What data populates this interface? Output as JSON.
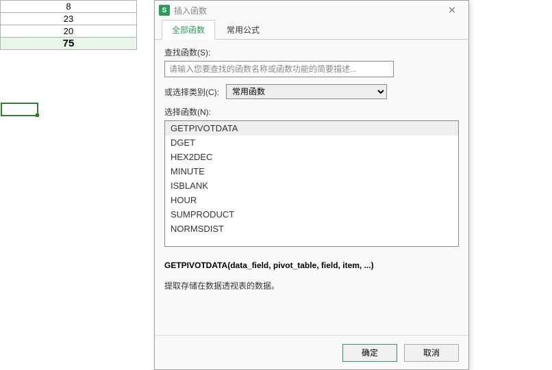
{
  "spreadsheet": {
    "cells": [
      "8",
      "23",
      "20",
      "75"
    ]
  },
  "dialog": {
    "title": "插入函数",
    "app_icon_letter": "S",
    "tabs": {
      "all": "全部函数",
      "common": "常用公式"
    },
    "search": {
      "label": "查找函数(S):",
      "placeholder": "请输入您要查找的函数名称或函数功能的简要描述..."
    },
    "category": {
      "label": "或选择类别(C):",
      "selected": "常用函数"
    },
    "select_fn_label": "选择函数(N):",
    "functions": [
      "GETPIVOTDATA",
      "DGET",
      "HEX2DEC",
      "MINUTE",
      "ISBLANK",
      "HOUR",
      "SUMPRODUCT",
      "NORMSDIST"
    ],
    "syntax": "GETPIVOTDATA(data_field, pivot_table, field, item, ...)",
    "description": "提取存储在数据透视表的数据。",
    "buttons": {
      "ok": "确定",
      "cancel": "取消"
    }
  }
}
